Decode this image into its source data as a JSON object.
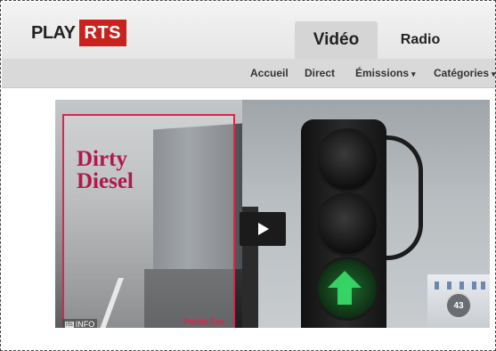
{
  "brand": {
    "play": "PLAY",
    "rts": "RTS",
    "rts_color": "#c9211e"
  },
  "tabs": [
    {
      "label": "Vidéo",
      "active": true
    },
    {
      "label": "Radio",
      "active": false
    }
  ],
  "subnav": [
    {
      "label": "Accueil"
    },
    {
      "label": "Direct"
    },
    {
      "label": "Émissions",
      "has_caret": true
    },
    {
      "label": "Catégories",
      "has_caret": true
    }
  ],
  "video": {
    "magazine_title_line1": "Dirty",
    "magazine_title_line2": "Diesel",
    "magazine_brand": "Public Eye",
    "channel_badge": "INFO",
    "channel_badge_prefix": "rts",
    "play_icon": "play-icon",
    "corner_number": "43"
  }
}
